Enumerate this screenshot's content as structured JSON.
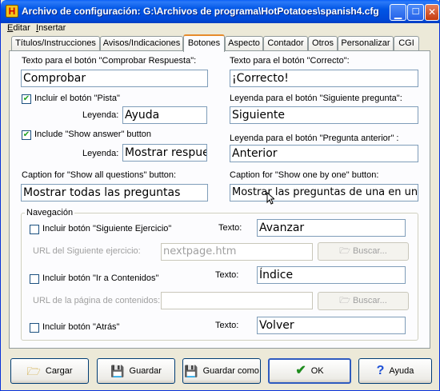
{
  "window": {
    "title": "Archivo de configuración: G:\\Archivos de programa\\HotPotatoes\\spanish4.cfg",
    "icon": "hot-potatoes-icon"
  },
  "menu": [
    "Editar",
    "Insertar"
  ],
  "tabs": [
    "Títulos/Instrucciones",
    "Avisos/Indicaciones",
    "Botones",
    "Aspecto",
    "Contador",
    "Otros",
    "Personalizar",
    "CGI"
  ],
  "active_tab": "Botones",
  "buttons_tab": {
    "check_label": "Texto para el botón \"Comprobar Respuesta\":",
    "check_value": "Comprobar",
    "correct_label": "Texto para el botón \"Correcto\":",
    "correct_value": "¡Correcto!",
    "hint_checkbox": "Incluir el botón \"Pista\"",
    "hint_caption_label": "Leyenda:",
    "hint_caption_value": "Ayuda",
    "next_q_label": "Leyenda para el botón \"Siguiente pregunta\":",
    "next_q_value": "Siguiente",
    "show_answer_checkbox": "Include \"Show answer\" button",
    "show_answer_caption_label": "Leyenda:",
    "show_answer_caption_value": "Mostrar respuest",
    "prev_q_label": "Leyenda para el botón \"Pregunta anterior\" :",
    "prev_q_value": "Anterior",
    "show_all_label": "Caption for \"Show all questions\" button:",
    "show_all_value": "Mostrar todas las preguntas",
    "show_one_label": "Caption for \"Show one by one\" button:",
    "show_one_value": "Mostrar las preguntas de una en una"
  },
  "navigation": {
    "title": "Navegación",
    "next_ex_checkbox": "Incluir botón \"Siguiente Ejercicio\"",
    "next_ex_text_label": "Texto:",
    "next_ex_text_value": "Avanzar",
    "next_ex_url_label": "URL del Siguiente ejercicio:",
    "next_ex_url_value": "nextpage.htm",
    "browse_label": "Buscar...",
    "contents_checkbox": "Incluir botón \"Ir a Contenidos\"",
    "contents_text_label": "Texto:",
    "contents_text_value": "Índice",
    "contents_url_label": "URL de la página de contenidos:",
    "contents_url_value": "",
    "back_checkbox": "Incluir botón \"Atrás\"",
    "back_text_label": "Texto:",
    "back_text_value": "Volver"
  },
  "footer": {
    "load": "Cargar",
    "save": "Guardar",
    "save_as": "Guardar como",
    "ok": "OK",
    "help": "Ayuda"
  },
  "colors": {
    "titlebar": "#0054e3",
    "check_green": "#21a121",
    "ok_check": "#1e8c1e",
    "help_question": "#1c4fd6"
  }
}
